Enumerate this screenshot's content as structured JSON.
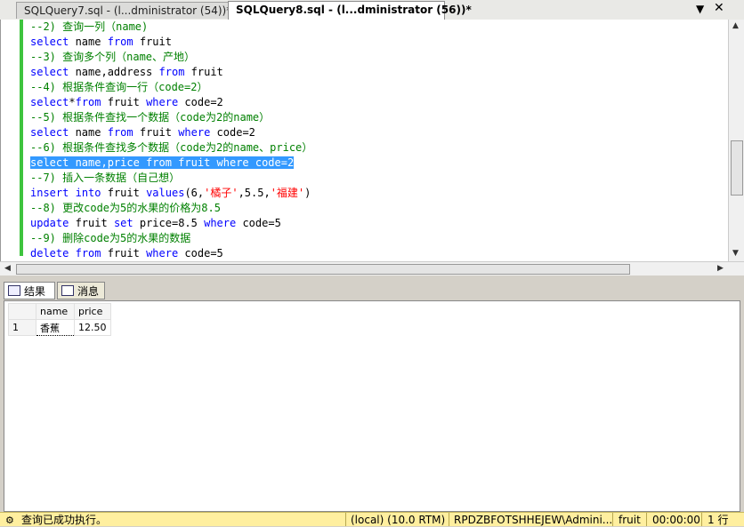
{
  "tabs": [
    {
      "label": "SQLQuery7.sql - (l...dministrator (54))*",
      "active": false
    },
    {
      "label": "SQLQuery8.sql - (l...dministrator (56))*",
      "active": true
    }
  ],
  "editor": {
    "lines": [
      [
        {
          "t": "--2) 查询一列（name)",
          "c": "cmt"
        }
      ],
      [
        {
          "t": "select",
          "c": "kw"
        },
        {
          "t": " name ",
          "c": "obj"
        },
        {
          "t": "from",
          "c": "kw"
        },
        {
          "t": " fruit",
          "c": "obj"
        }
      ],
      [
        {
          "t": "--3) 查询多个列（name、产地）",
          "c": "cmt"
        }
      ],
      [
        {
          "t": "select",
          "c": "kw"
        },
        {
          "t": " name,address ",
          "c": "obj"
        },
        {
          "t": "from",
          "c": "kw"
        },
        {
          "t": " fruit",
          "c": "obj"
        }
      ],
      [
        {
          "t": "--4) 根据条件查询一行（code=2）",
          "c": "cmt"
        }
      ],
      [
        {
          "t": "select",
          "c": "kw"
        },
        {
          "t": "*",
          "c": "obj"
        },
        {
          "t": "from",
          "c": "kw"
        },
        {
          "t": " fruit ",
          "c": "obj"
        },
        {
          "t": "where",
          "c": "kw"
        },
        {
          "t": " code=2",
          "c": "obj"
        }
      ],
      [
        {
          "t": "--5) 根据条件查找一个数据（code为2的name）",
          "c": "cmt"
        }
      ],
      [
        {
          "t": "select",
          "c": "kw"
        },
        {
          "t": " name ",
          "c": "obj"
        },
        {
          "t": "from",
          "c": "kw"
        },
        {
          "t": " fruit ",
          "c": "obj"
        },
        {
          "t": "where",
          "c": "kw"
        },
        {
          "t": " code=2",
          "c": "obj"
        }
      ],
      [
        {
          "t": "--6) 根据条件查找多个数据（code为2的name、price）",
          "c": "cmt"
        }
      ],
      [
        {
          "t": "select name,price from fruit where code=2",
          "c": "sel"
        }
      ],
      [
        {
          "t": "--7) 插入一条数据（自己想）",
          "c": "cmt"
        }
      ],
      [
        {
          "t": "insert",
          "c": "kw"
        },
        {
          "t": " ",
          "c": "obj"
        },
        {
          "t": "into",
          "c": "kw"
        },
        {
          "t": " fruit ",
          "c": "obj"
        },
        {
          "t": "values",
          "c": "kw"
        },
        {
          "t": "(6,",
          "c": "obj"
        },
        {
          "t": "'橘子'",
          "c": "str"
        },
        {
          "t": ",5.5,",
          "c": "obj"
        },
        {
          "t": "'福建'",
          "c": "str"
        },
        {
          "t": ")",
          "c": "obj"
        }
      ],
      [
        {
          "t": "--8) 更改code为5的水果的价格为8.5",
          "c": "cmt"
        }
      ],
      [
        {
          "t": "update",
          "c": "kw"
        },
        {
          "t": " fruit ",
          "c": "obj"
        },
        {
          "t": "set",
          "c": "kw"
        },
        {
          "t": " price=8.5 ",
          "c": "obj"
        },
        {
          "t": "where",
          "c": "kw"
        },
        {
          "t": " code=5",
          "c": "obj"
        }
      ],
      [
        {
          "t": "--9) 删除code为5的水果的数据",
          "c": "cmt"
        }
      ],
      [
        {
          "t": "delete",
          "c": "kw"
        },
        {
          "t": " ",
          "c": "obj"
        },
        {
          "t": "from",
          "c": "kw"
        },
        {
          "t": " fruit ",
          "c": "obj"
        },
        {
          "t": "where",
          "c": "kw"
        },
        {
          "t": " code=5",
          "c": "obj"
        }
      ]
    ]
  },
  "result_tabs": [
    {
      "label": "结果",
      "active": true,
      "icon": "grid-icon"
    },
    {
      "label": "消息",
      "active": false,
      "icon": "message-icon"
    }
  ],
  "results": {
    "columns": [
      "name",
      "price"
    ],
    "rows": [
      [
        "1",
        "香蕉",
        "12.50"
      ]
    ]
  },
  "status": {
    "message": "查询已成功执行。",
    "server": "(local) (10.0 RTM)",
    "user": "RPDZBFOTSHHEJEW\\Admini...",
    "database": "fruit",
    "time": "00:00:00",
    "rows": "1 行"
  },
  "colors": {
    "comment": "#008000",
    "keyword": "#0000ff",
    "string": "#ff0000",
    "selection": "#3399ff",
    "status_bg": "#ffef9f"
  }
}
